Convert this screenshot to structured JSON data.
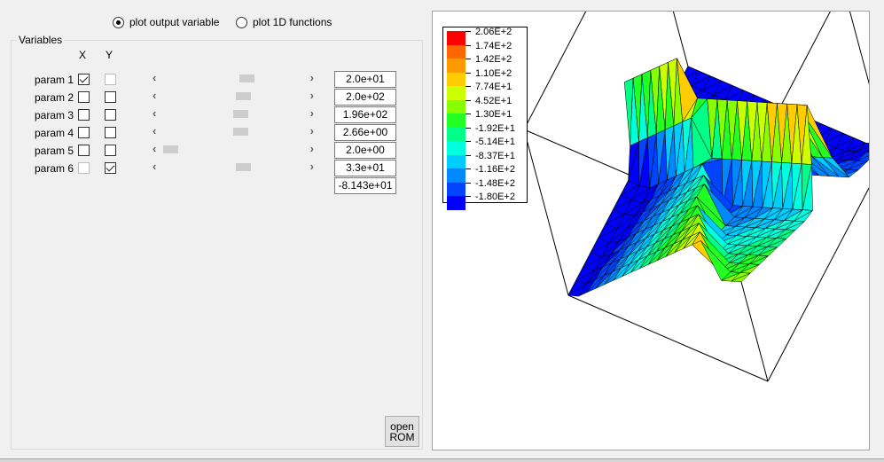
{
  "mode": {
    "option1": "plot output variable",
    "option2": "plot 1D functions",
    "selected": 1
  },
  "variables": {
    "group_title": "Variables",
    "col_x": "X",
    "col_y": "Y",
    "params": [
      {
        "label": "param 1",
        "x": true,
        "x_enabled": true,
        "y": false,
        "y_enabled": false,
        "slider_pos": 0.6,
        "value": "2.0e+01"
      },
      {
        "label": "param 2",
        "x": false,
        "x_enabled": true,
        "y": false,
        "y_enabled": true,
        "slider_pos": 0.57,
        "value": "2.0e+02"
      },
      {
        "label": "param 3",
        "x": false,
        "x_enabled": true,
        "y": false,
        "y_enabled": true,
        "slider_pos": 0.55,
        "value": "1.96e+02"
      },
      {
        "label": "param 4",
        "x": false,
        "x_enabled": true,
        "y": false,
        "y_enabled": true,
        "slider_pos": 0.55,
        "value": "2.66e+00"
      },
      {
        "label": "param 5",
        "x": false,
        "x_enabled": true,
        "y": false,
        "y_enabled": true,
        "slider_pos": 0.0,
        "value": "2.0e+00"
      },
      {
        "label": "param 6",
        "x": false,
        "x_enabled": false,
        "y": true,
        "y_enabled": true,
        "slider_pos": 0.57,
        "value": "3.3e+01"
      }
    ],
    "output_value": "-8.143e+01"
  },
  "open_rom_label": [
    "open",
    "ROM"
  ],
  "legend": {
    "items": [
      {
        "label": "2.06E+2",
        "color": "#ff0000"
      },
      {
        "label": "1.74E+2",
        "color": "#ff6600"
      },
      {
        "label": "1.42E+2",
        "color": "#ff9900"
      },
      {
        "label": "1.10E+2",
        "color": "#ffcc00"
      },
      {
        "label": "7.74E+1",
        "color": "#ccff00"
      },
      {
        "label": "4.52E+1",
        "color": "#88ff00"
      },
      {
        "label": "1.30E+1",
        "color": "#22ff22"
      },
      {
        "label": "-1.92E+1",
        "color": "#00ff88"
      },
      {
        "label": "-5.14E+1",
        "color": "#00ffdd"
      },
      {
        "label": "-8.37E+1",
        "color": "#00ccff"
      },
      {
        "label": "-1.16E+2",
        "color": "#0088ff"
      },
      {
        "label": "-1.48E+2",
        "color": "#0044ff"
      },
      {
        "label": "-1.80E+2",
        "color": "#0000ff"
      }
    ]
  },
  "surface": {
    "colormap_min": -180,
    "colormap_max": 206
  }
}
